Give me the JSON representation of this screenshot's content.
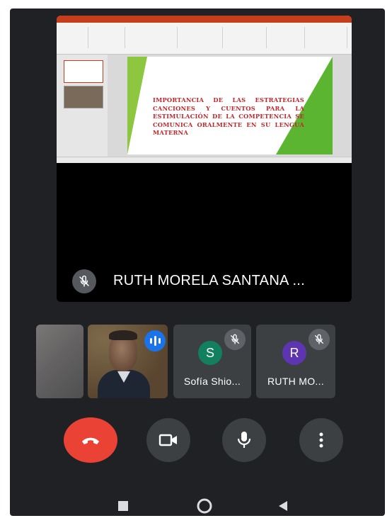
{
  "meeting": {
    "presenter": {
      "name": "RUTH MORELA SANTANA ...",
      "muted": true
    },
    "shared_slide": {
      "text": "IMPORTANCIA DE LAS ESTRATEGIAS CANCIONES Y CUENTOS PARA LA ESTIMULACIÓN DE LA COMPETENCIA SE COMUNICA ORALMENTE EN SU LENGUA MATERNA",
      "text_color": "#c0282d",
      "accent_colors": [
        "#8dc63f",
        "#5cb531"
      ],
      "app_color": "#c43e1c"
    },
    "participants": [
      {
        "id": "blurred",
        "label": "",
        "video": "blurred"
      },
      {
        "id": "camera",
        "label": "",
        "video": "camera",
        "speaking": true
      },
      {
        "id": "sofia",
        "label": "Sofía Shio...",
        "initial": "S",
        "avatar_color": "#12805c",
        "muted": true
      },
      {
        "id": "ruth",
        "label": "RUTH MO...",
        "initial": "R",
        "avatar_color": "#5d35b1",
        "muted": true
      }
    ]
  },
  "controls": {
    "end_call": {
      "icon": "phone-hangup-icon",
      "color": "#ea4335"
    },
    "camera": {
      "icon": "video-camera-icon"
    },
    "microphone": {
      "icon": "microphone-icon"
    },
    "more": {
      "icon": "more-vert-icon"
    }
  },
  "system_nav": {
    "recents": "square-icon",
    "home": "circle-icon",
    "back": "triangle-back-icon"
  }
}
